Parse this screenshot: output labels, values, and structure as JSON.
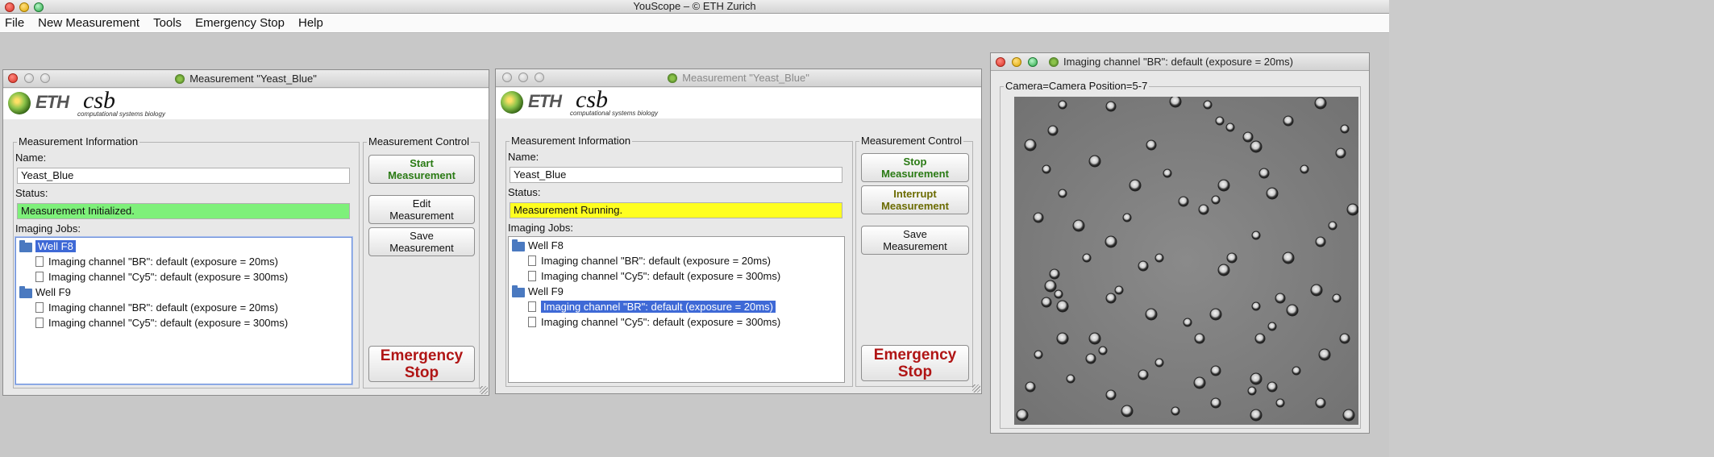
{
  "app": {
    "title": "YouScope – © ETH Zurich",
    "menu": [
      "File",
      "New Measurement",
      "Tools",
      "Emergency Stop",
      "Help"
    ]
  },
  "logo": {
    "eth": "ETH",
    "csb": "csb",
    "sub": "computational systems biology"
  },
  "window1": {
    "title": "Measurement \"Yeast_Blue\"",
    "info_legend": "Measurement Information",
    "name_label": "Name:",
    "name_value": "Yeast_Blue",
    "status_label": "Status:",
    "status_value": "Measurement Initialized.",
    "status_color": "#7ef07a",
    "jobs_label": "Imaging Jobs:",
    "tree": [
      {
        "type": "folder",
        "label": "Well F8",
        "selected": true
      },
      {
        "type": "doc",
        "label": "Imaging channel \"BR\": default (exposure = 20ms)"
      },
      {
        "type": "doc",
        "label": "Imaging channel \"Cy5\": default (exposure = 300ms)"
      },
      {
        "type": "folder",
        "label": "Well F9"
      },
      {
        "type": "doc",
        "label": "Imaging channel \"BR\": default (exposure = 20ms)"
      },
      {
        "type": "doc",
        "label": "Imaging channel \"Cy5\": default (exposure = 300ms)"
      }
    ],
    "control_legend": "Measurement Control",
    "buttons": {
      "start": "Start\nMeasurement",
      "edit": "Edit\nMeasurement",
      "save": "Save\nMeasurement",
      "emergency": "Emergency\nStop"
    }
  },
  "window2": {
    "title": "Measurement \"Yeast_Blue\"",
    "info_legend": "Measurement Information",
    "name_label": "Name:",
    "name_value": "Yeast_Blue",
    "status_label": "Status:",
    "status_value": "Measurement Running.",
    "status_color": "#ffff20",
    "jobs_label": "Imaging Jobs:",
    "tree": [
      {
        "type": "folder",
        "label": "Well F8"
      },
      {
        "type": "doc",
        "label": "Imaging channel \"BR\": default (exposure = 20ms)"
      },
      {
        "type": "doc",
        "label": "Imaging channel \"Cy5\": default (exposure = 300ms)"
      },
      {
        "type": "folder",
        "label": "Well F9"
      },
      {
        "type": "doc",
        "label": "Imaging channel \"BR\": default (exposure = 20ms)",
        "selected": true
      },
      {
        "type": "doc",
        "label": "Imaging channel \"Cy5\": default (exposure = 300ms)"
      }
    ],
    "control_legend": "Measurement Control",
    "buttons": {
      "stop": "Stop\nMeasurement",
      "interrupt": "Interrupt\nMeasurement",
      "save": "Save\nMeasurement",
      "emergency": "Emergency\nStop"
    }
  },
  "window3": {
    "title": "Imaging channel \"BR\": default (exposure = 20ms)",
    "frame_label": "Camera=Camera Position=5-7"
  },
  "colors": {
    "selection": "#3e69d6",
    "emergency_text": "#b01515",
    "start_text": "#2a7a14"
  }
}
